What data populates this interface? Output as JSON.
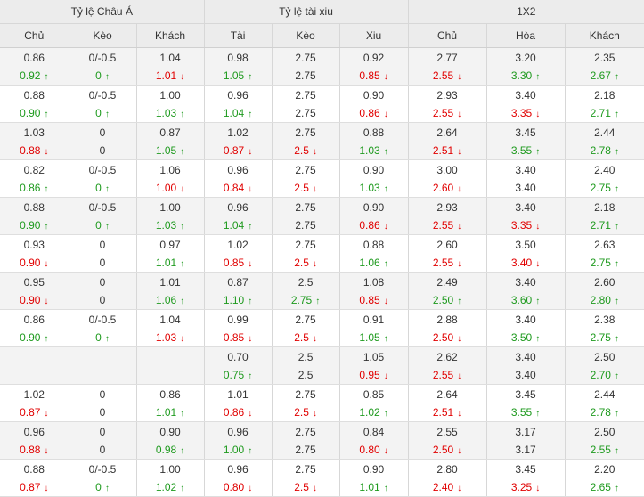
{
  "groups": [
    "Tỷ lệ Châu Á",
    "Tỷ lệ tài xiu",
    "1X2"
  ],
  "columns": [
    "Chủ",
    "Kèo",
    "Khách",
    "Tài",
    "Kèo",
    "Xiu",
    "Chủ",
    "Hòa",
    "Khách"
  ],
  "colors": {
    "up": "#1e9a1e",
    "down": "#e10000",
    "header_bg": "#ececec",
    "alt_row_bg": "#f3f3f3"
  },
  "icons": {
    "up": "↑",
    "down": "↓"
  },
  "rows": [
    {
      "open": [
        "0.86",
        "0/-0.5",
        "1.04",
        "0.98",
        "2.75",
        "0.92",
        "2.77",
        "3.20",
        "2.35"
      ],
      "live": [
        {
          "v": "0.92",
          "d": "up"
        },
        {
          "v": "0",
          "d": "up"
        },
        {
          "v": "1.01",
          "d": "down"
        },
        {
          "v": "1.05",
          "d": "up"
        },
        {
          "v": "2.75",
          "d": ""
        },
        {
          "v": "0.85",
          "d": "down"
        },
        {
          "v": "2.55",
          "d": "down"
        },
        {
          "v": "3.30",
          "d": "up"
        },
        {
          "v": "2.67",
          "d": "up"
        }
      ]
    },
    {
      "open": [
        "0.88",
        "0/-0.5",
        "1.00",
        "0.96",
        "2.75",
        "0.90",
        "2.93",
        "3.40",
        "2.18"
      ],
      "live": [
        {
          "v": "0.90",
          "d": "up"
        },
        {
          "v": "0",
          "d": "up"
        },
        {
          "v": "1.03",
          "d": "up"
        },
        {
          "v": "1.04",
          "d": "up"
        },
        {
          "v": "2.75",
          "d": ""
        },
        {
          "v": "0.86",
          "d": "down"
        },
        {
          "v": "2.55",
          "d": "down"
        },
        {
          "v": "3.35",
          "d": "down"
        },
        {
          "v": "2.71",
          "d": "up"
        }
      ]
    },
    {
      "open": [
        "1.03",
        "0",
        "0.87",
        "1.02",
        "2.75",
        "0.88",
        "2.64",
        "3.45",
        "2.44"
      ],
      "live": [
        {
          "v": "0.88",
          "d": "down"
        },
        {
          "v": "0",
          "d": ""
        },
        {
          "v": "1.05",
          "d": "up"
        },
        {
          "v": "0.87",
          "d": "down"
        },
        {
          "v": "2.5",
          "d": "down"
        },
        {
          "v": "1.03",
          "d": "up"
        },
        {
          "v": "2.51",
          "d": "down"
        },
        {
          "v": "3.55",
          "d": "up"
        },
        {
          "v": "2.78",
          "d": "up"
        }
      ]
    },
    {
      "open": [
        "0.82",
        "0/-0.5",
        "1.06",
        "0.96",
        "2.75",
        "0.90",
        "3.00",
        "3.40",
        "2.40"
      ],
      "live": [
        {
          "v": "0.86",
          "d": "up"
        },
        {
          "v": "0",
          "d": "up"
        },
        {
          "v": "1.00",
          "d": "down"
        },
        {
          "v": "0.84",
          "d": "down"
        },
        {
          "v": "2.5",
          "d": "down"
        },
        {
          "v": "1.03",
          "d": "up"
        },
        {
          "v": "2.60",
          "d": "down"
        },
        {
          "v": "3.40",
          "d": ""
        },
        {
          "v": "2.75",
          "d": "up"
        }
      ]
    },
    {
      "open": [
        "0.88",
        "0/-0.5",
        "1.00",
        "0.96",
        "2.75",
        "0.90",
        "2.93",
        "3.40",
        "2.18"
      ],
      "live": [
        {
          "v": "0.90",
          "d": "up"
        },
        {
          "v": "0",
          "d": "up"
        },
        {
          "v": "1.03",
          "d": "up"
        },
        {
          "v": "1.04",
          "d": "up"
        },
        {
          "v": "2.75",
          "d": ""
        },
        {
          "v": "0.86",
          "d": "down"
        },
        {
          "v": "2.55",
          "d": "down"
        },
        {
          "v": "3.35",
          "d": "down"
        },
        {
          "v": "2.71",
          "d": "up"
        }
      ]
    },
    {
      "open": [
        "0.93",
        "0",
        "0.97",
        "1.02",
        "2.75",
        "0.88",
        "2.60",
        "3.50",
        "2.63"
      ],
      "live": [
        {
          "v": "0.90",
          "d": "down"
        },
        {
          "v": "0",
          "d": ""
        },
        {
          "v": "1.01",
          "d": "up"
        },
        {
          "v": "0.85",
          "d": "down"
        },
        {
          "v": "2.5",
          "d": "down"
        },
        {
          "v": "1.06",
          "d": "up"
        },
        {
          "v": "2.55",
          "d": "down"
        },
        {
          "v": "3.40",
          "d": "down"
        },
        {
          "v": "2.75",
          "d": "up"
        }
      ]
    },
    {
      "open": [
        "0.95",
        "0",
        "1.01",
        "0.87",
        "2.5",
        "1.08",
        "2.49",
        "3.40",
        "2.60"
      ],
      "live": [
        {
          "v": "0.90",
          "d": "down"
        },
        {
          "v": "0",
          "d": ""
        },
        {
          "v": "1.06",
          "d": "up"
        },
        {
          "v": "1.10",
          "d": "up"
        },
        {
          "v": "2.75",
          "d": "up"
        },
        {
          "v": "0.85",
          "d": "down"
        },
        {
          "v": "2.50",
          "d": "up"
        },
        {
          "v": "3.60",
          "d": "up"
        },
        {
          "v": "2.80",
          "d": "up"
        }
      ]
    },
    {
      "open": [
        "0.86",
        "0/-0.5",
        "1.04",
        "0.99",
        "2.75",
        "0.91",
        "2.88",
        "3.40",
        "2.38"
      ],
      "live": [
        {
          "v": "0.90",
          "d": "up"
        },
        {
          "v": "0",
          "d": "up"
        },
        {
          "v": "1.03",
          "d": "down"
        },
        {
          "v": "0.85",
          "d": "down"
        },
        {
          "v": "2.5",
          "d": "down"
        },
        {
          "v": "1.05",
          "d": "up"
        },
        {
          "v": "2.50",
          "d": "down"
        },
        {
          "v": "3.50",
          "d": "up"
        },
        {
          "v": "2.75",
          "d": "up"
        }
      ]
    },
    {
      "open": [
        "",
        "",
        "",
        "0.70",
        "2.5",
        "1.05",
        "2.62",
        "3.40",
        "2.50"
      ],
      "live": [
        {
          "v": "",
          "d": ""
        },
        {
          "v": "",
          "d": ""
        },
        {
          "v": "",
          "d": ""
        },
        {
          "v": "0.75",
          "d": "up"
        },
        {
          "v": "2.5",
          "d": ""
        },
        {
          "v": "0.95",
          "d": "down"
        },
        {
          "v": "2.55",
          "d": "down"
        },
        {
          "v": "3.40",
          "d": ""
        },
        {
          "v": "2.70",
          "d": "up"
        }
      ]
    },
    {
      "open": [
        "1.02",
        "0",
        "0.86",
        "1.01",
        "2.75",
        "0.85",
        "2.64",
        "3.45",
        "2.44"
      ],
      "live": [
        {
          "v": "0.87",
          "d": "down"
        },
        {
          "v": "0",
          "d": ""
        },
        {
          "v": "1.01",
          "d": "up"
        },
        {
          "v": "0.86",
          "d": "down"
        },
        {
          "v": "2.5",
          "d": "down"
        },
        {
          "v": "1.02",
          "d": "up"
        },
        {
          "v": "2.51",
          "d": "down"
        },
        {
          "v": "3.55",
          "d": "up"
        },
        {
          "v": "2.78",
          "d": "up"
        }
      ]
    },
    {
      "open": [
        "0.96",
        "0",
        "0.90",
        "0.96",
        "2.75",
        "0.84",
        "2.55",
        "3.17",
        "2.50"
      ],
      "live": [
        {
          "v": "0.88",
          "d": "down"
        },
        {
          "v": "0",
          "d": ""
        },
        {
          "v": "0.98",
          "d": "up"
        },
        {
          "v": "1.00",
          "d": "up"
        },
        {
          "v": "2.75",
          "d": ""
        },
        {
          "v": "0.80",
          "d": "down"
        },
        {
          "v": "2.50",
          "d": "down"
        },
        {
          "v": "3.17",
          "d": ""
        },
        {
          "v": "2.55",
          "d": "up"
        }
      ]
    },
    {
      "open": [
        "0.88",
        "0/-0.5",
        "1.00",
        "0.96",
        "2.75",
        "0.90",
        "2.80",
        "3.45",
        "2.20"
      ],
      "live": [
        {
          "v": "0.87",
          "d": "down"
        },
        {
          "v": "0",
          "d": "up"
        },
        {
          "v": "1.02",
          "d": "up"
        },
        {
          "v": "0.80",
          "d": "down"
        },
        {
          "v": "2.5",
          "d": "down"
        },
        {
          "v": "1.01",
          "d": "up"
        },
        {
          "v": "2.40",
          "d": "down"
        },
        {
          "v": "3.25",
          "d": "down"
        },
        {
          "v": "2.65",
          "d": "up"
        }
      ]
    }
  ]
}
